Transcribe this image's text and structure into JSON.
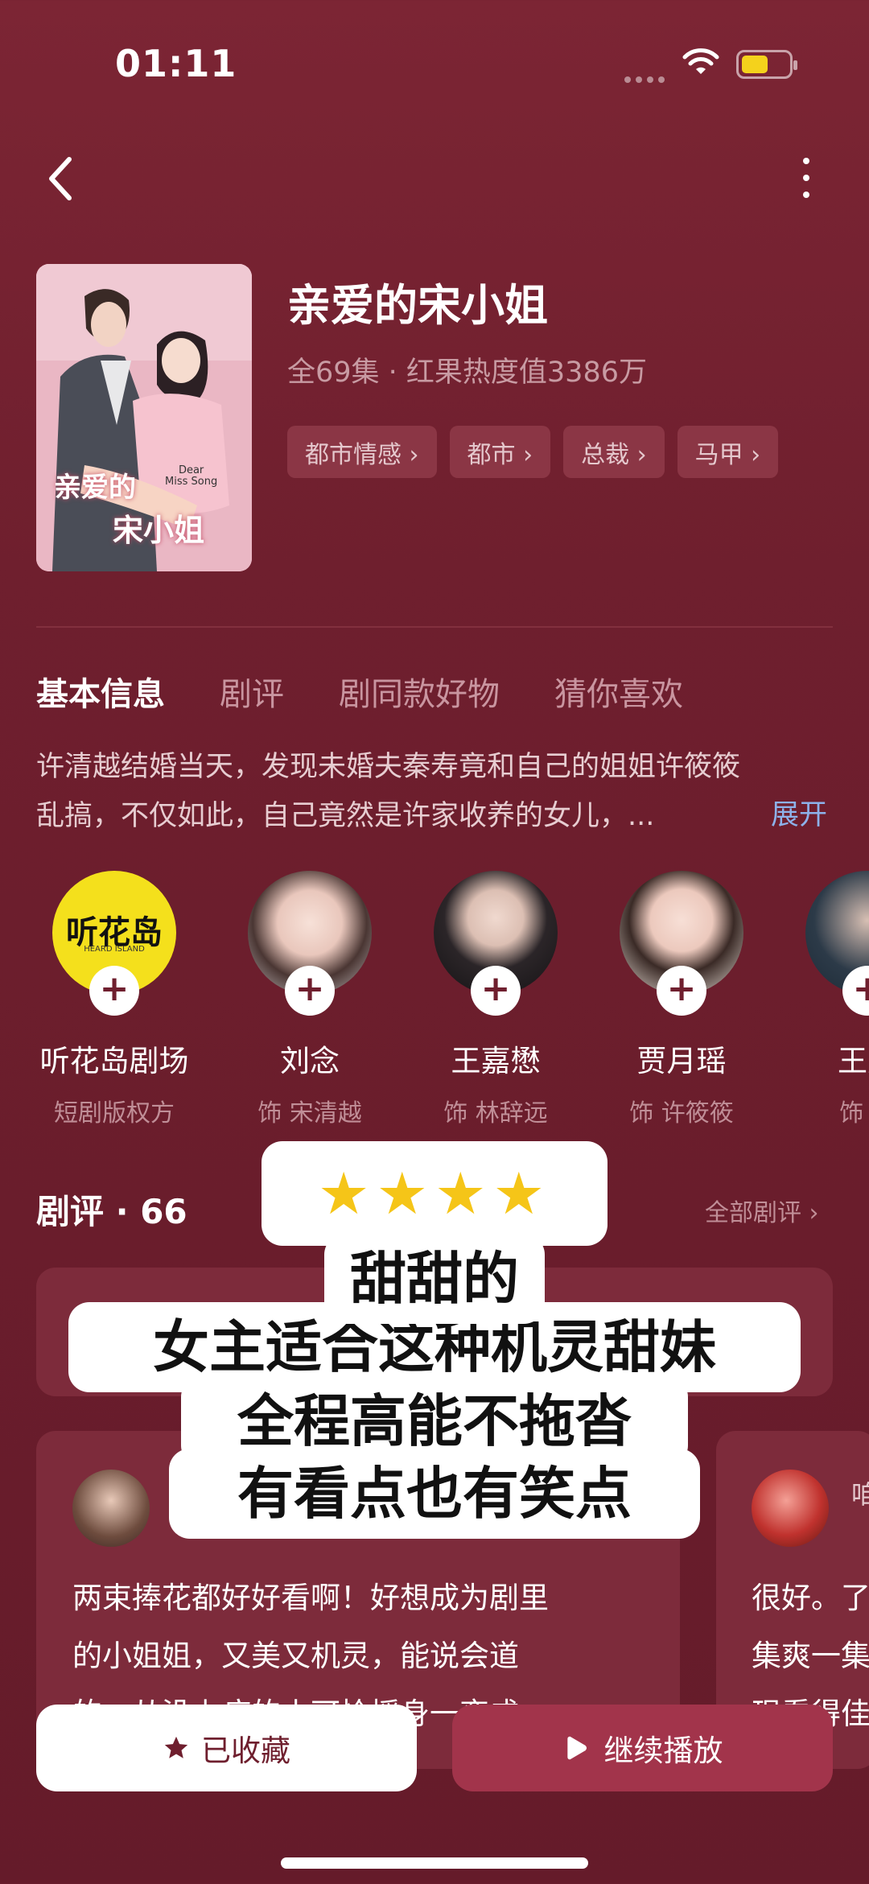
{
  "status_bar": {
    "time": "01:11"
  },
  "drama": {
    "title": "亲爱的宋小姐",
    "subtitle": "全69集 · 红果热度值3386万",
    "tags": [
      "都市情感 ›",
      "都市 ›",
      "总裁 ›",
      "马甲 ›"
    ],
    "poster_lines": [
      "亲爱的",
      "宋小姐",
      "Dear",
      "Miss Song"
    ]
  },
  "tabs": [
    "基本信息",
    "剧评",
    "剧同款好物",
    "猜你喜欢"
  ],
  "description": {
    "line1": "许清越结婚当天，发现未婚夫秦寿竟和自己的姐姐许筱筱",
    "line2": "乱搞，不仅如此，自己竟然是许家收养的女儿，...",
    "expand": "展开"
  },
  "cast": [
    {
      "name": "听花岛剧场",
      "role": "短剧版权方",
      "logo": "听花岛",
      "logo_sub": "HEARD ISLAND"
    },
    {
      "name": "刘念",
      "role": "饰 宋清越"
    },
    {
      "name": "王嘉懋",
      "role": "饰 林辞远"
    },
    {
      "name": "贾月瑶",
      "role": "饰 许筱筱"
    },
    {
      "name": "王矢",
      "role": "饰 王"
    }
  ],
  "reviews": {
    "header": "剧评 · 66",
    "all_link": "全部剧评 ›",
    "items": [
      {
        "lines": [
          "两束捧花都好好看啊！好想成为剧里",
          "的小姐姐，又美又机灵，能说会道",
          "的，从没上病的小可怜摇身一变成"
        ]
      },
      {
        "lines": [
          "很好。了",
          "集爽一集",
          "现看得佳"
        ],
        "name_fragment": "咱"
      }
    ]
  },
  "overlay": {
    "stars": "★★★★",
    "lines": [
      "甜甜的",
      "女主适合这种机灵甜妹",
      "全程高能不拖沓",
      "有看点也有笑点"
    ]
  },
  "buttons": {
    "favorite": "已收藏",
    "play": "继续播放"
  },
  "colors": {
    "background": "#6f1f2e",
    "tag_bg": "#8b3645",
    "play_button": "#a2344b",
    "expand_link": "#8db2ea",
    "logo_yellow": "#f4e01c"
  }
}
